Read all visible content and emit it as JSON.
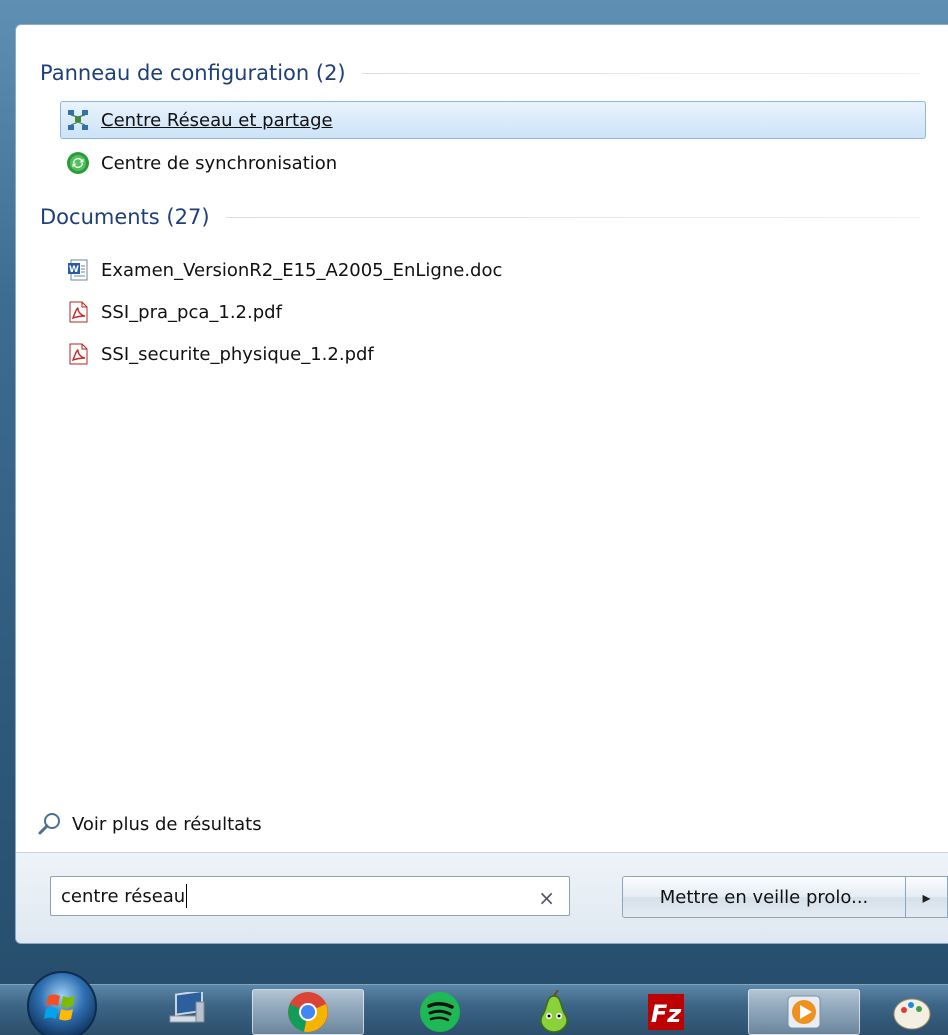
{
  "groups": [
    {
      "title": "Panneau de configuration (2)",
      "items": [
        {
          "label": "Centre Réseau et partage",
          "icon": "network-icon",
          "selected": true
        },
        {
          "label": "Centre de synchronisation",
          "icon": "sync-icon",
          "selected": false
        }
      ]
    },
    {
      "title": "Documents (27)",
      "items": [
        {
          "label": "Examen_VersionR2_E15_A2005_EnLigne.doc",
          "icon": "word-doc-icon"
        },
        {
          "label": "SSI_pra_pca_1.2.pdf",
          "icon": "pdf-icon"
        },
        {
          "label": "SSI_securite_physique_1.2.pdf",
          "icon": "pdf-icon"
        }
      ]
    }
  ],
  "see_more_label": "Voir plus de résultats",
  "search": {
    "value": "centre réseau",
    "clear_glyph": "×"
  },
  "power": {
    "label": "Mettre en veille prolo...",
    "arrow_glyph": "▸"
  },
  "taskbar": {
    "items": [
      "start-orb-icon",
      "computer-icon",
      "chrome-icon",
      "spotify-icon",
      "pear-icon",
      "filezilla-icon",
      "media-player-icon",
      "paint-icon"
    ]
  },
  "colors": {
    "group_title": "#1e3f7a",
    "selection_bg": "#cde3f8",
    "selection_border": "#8fb6dc"
  }
}
